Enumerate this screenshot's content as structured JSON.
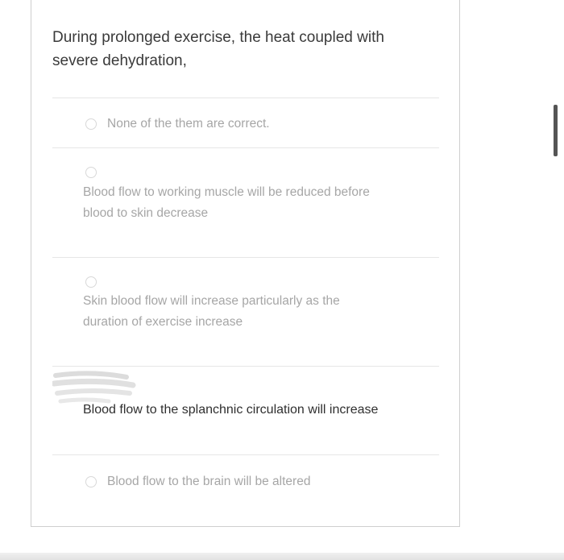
{
  "question": {
    "text": "During prolonged exercise, the heat coupled with severe dehydration,"
  },
  "options": [
    {
      "label": "None of the them are correct.",
      "selected": false
    },
    {
      "label": "Blood flow to working muscle will be reduced before blood to skin decrease",
      "selected": false
    },
    {
      "label": "Skin blood flow will increase particularly as the duration of exercise increase",
      "selected": false
    },
    {
      "label": "Blood flow to the splanchnic circulation will increase",
      "selected": false
    },
    {
      "label": "Blood flow to the brain will be altered",
      "selected": false
    }
  ],
  "colors": {
    "question_text": "#3a3a3a",
    "option_text_muted": "#a6a6a6",
    "option_text_dark": "#2f2f2f",
    "divider": "#e6e6e6",
    "radio_border": "#d8d8d8"
  }
}
